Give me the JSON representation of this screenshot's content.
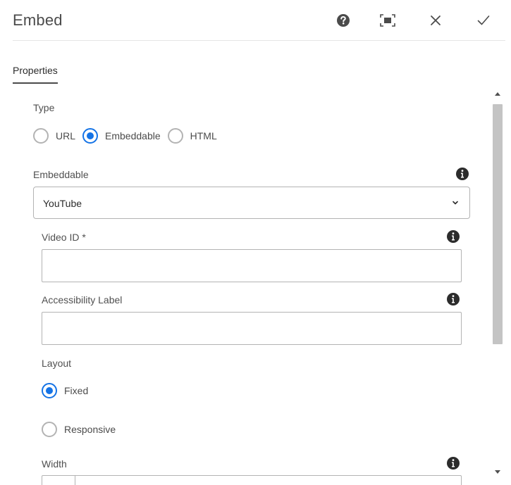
{
  "dialog": {
    "title": "Embed",
    "icons": {
      "help": "help-icon",
      "fullscreen": "fullscreen-icon",
      "close": "close-icon",
      "done": "checkmark-icon"
    }
  },
  "tabs": [
    {
      "label": "Properties"
    }
  ],
  "type": {
    "label": "Type",
    "options": [
      {
        "label": "URL",
        "selected": false
      },
      {
        "label": "Embeddable",
        "selected": true
      },
      {
        "label": "HTML",
        "selected": false
      }
    ]
  },
  "embeddable": {
    "label": "Embeddable",
    "value": "YouTube"
  },
  "video_id": {
    "label": "Video ID *",
    "value": ""
  },
  "accessibility_label": {
    "label": "Accessibility Label",
    "value": ""
  },
  "layout": {
    "label": "Layout",
    "options": [
      {
        "label": "Fixed",
        "selected": true
      },
      {
        "label": "Responsive",
        "selected": false
      }
    ]
  },
  "width": {
    "label": "Width"
  },
  "colors": {
    "accent": "#1473e6",
    "text": "#4b4b4b",
    "border": "#b3b3b3"
  }
}
